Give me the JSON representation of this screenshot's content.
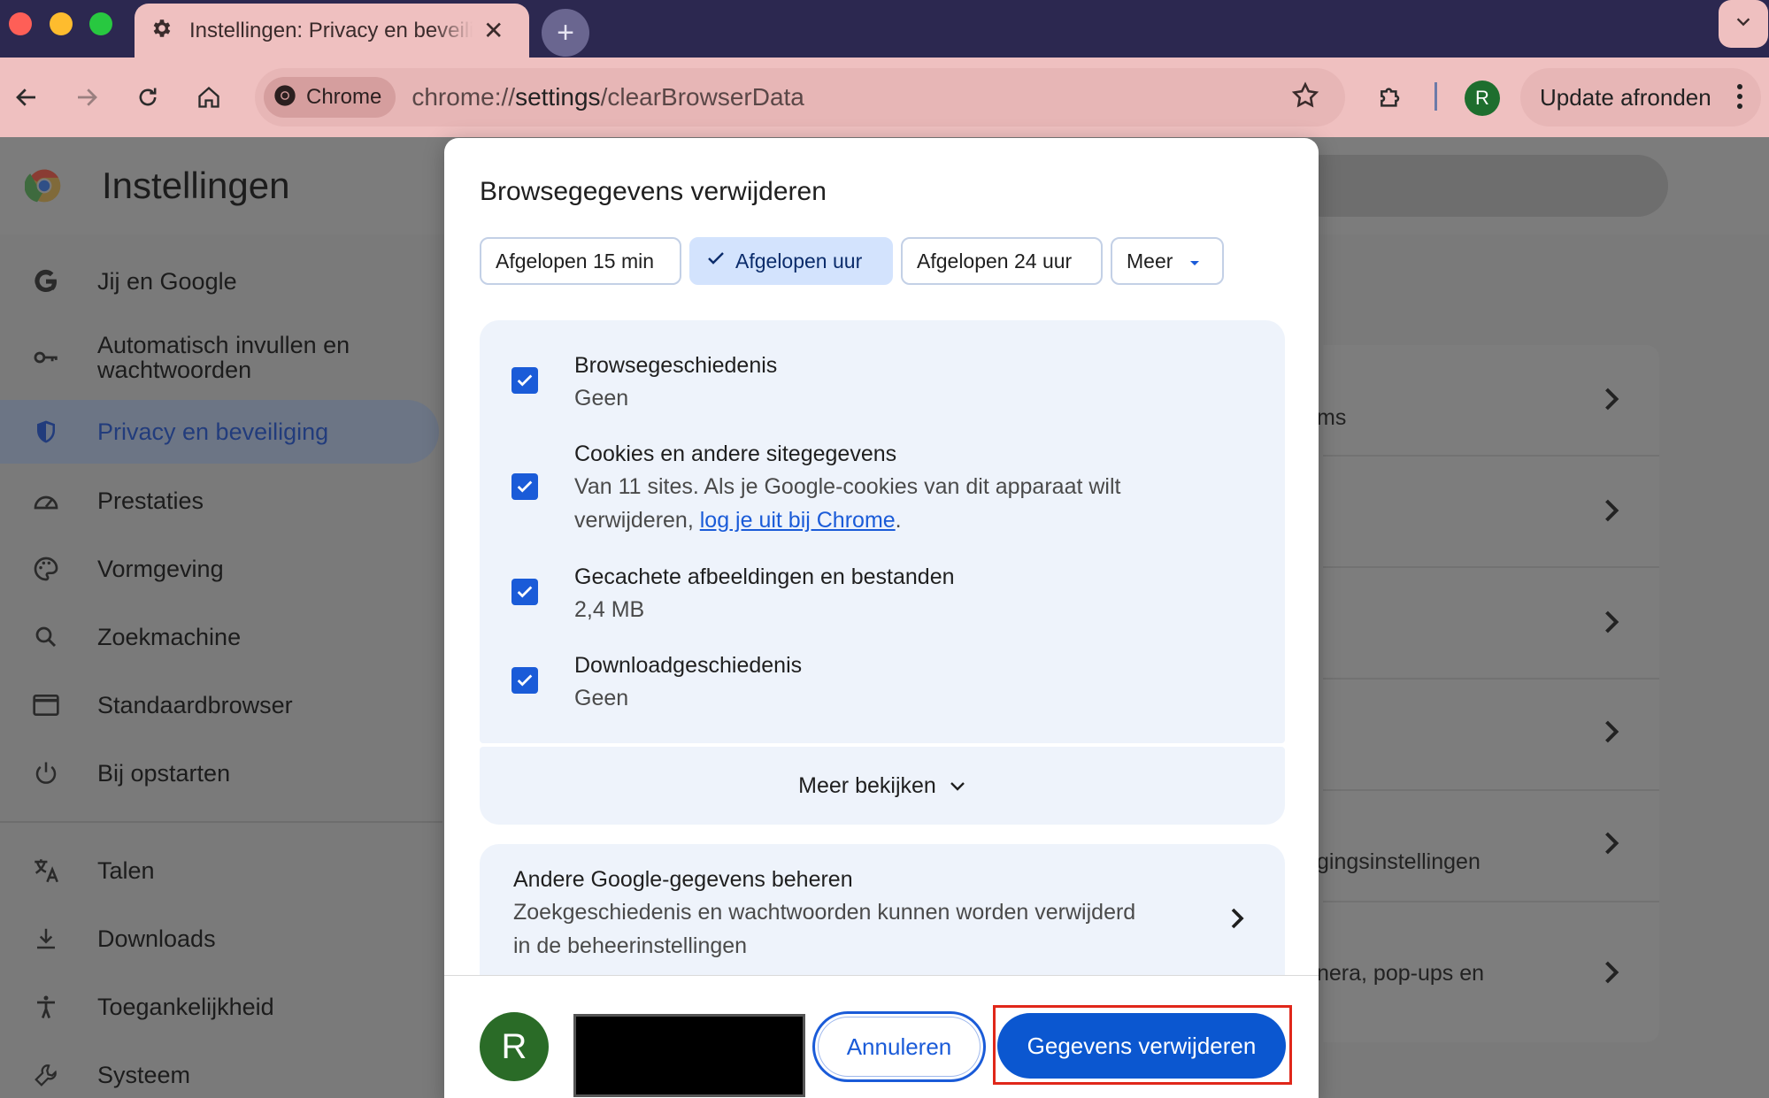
{
  "browser": {
    "tab_title": "Instellingen: Privacy en beveiliging",
    "tab_close": "✕",
    "new_tab": "+",
    "omnibox_chip": "Chrome",
    "url_prefix": "chrome://",
    "url_bold": "settings",
    "url_rest": "/clearBrowserData",
    "update_label": "Update afronden",
    "profile_initial": "R",
    "colors": {
      "titlebar": "#2c2850",
      "toolbar": "#efc0c0"
    }
  },
  "settings": {
    "title": "Instellingen",
    "sidebar": [
      {
        "label": "Jij en Google",
        "icon": "google-g-icon"
      },
      {
        "label": "Automatisch invullen en wachtwoorden",
        "icon": "key-icon"
      },
      {
        "label": "Privacy en beveiliging",
        "icon": "shield-icon",
        "active": true
      },
      {
        "label": "Prestaties",
        "icon": "gauge-icon"
      },
      {
        "label": "Vormgeving",
        "icon": "palette-icon"
      },
      {
        "label": "Zoekmachine",
        "icon": "search-icon"
      },
      {
        "label": "Standaardbrowser",
        "icon": "browser-window-icon"
      },
      {
        "label": "Bij opstarten",
        "icon": "power-icon"
      },
      {
        "label": "Talen",
        "icon": "translate-icon"
      },
      {
        "label": "Downloads",
        "icon": "download-icon"
      },
      {
        "label": "Toegankelijkheid",
        "icon": "accessibility-icon"
      },
      {
        "label": "Systeem",
        "icon": "wrench-icon"
      }
    ],
    "card_fragments": [
      "ms",
      "gingsinstellingen",
      "nera, pop-ups en"
    ]
  },
  "dialog": {
    "title": "Browsegegevens verwijderen",
    "time_ranges": [
      {
        "label": "Afgelopen 15 min",
        "selected": false
      },
      {
        "label": "Afgelopen uur",
        "selected": true
      },
      {
        "label": "Afgelopen 24 uur",
        "selected": false
      },
      {
        "label": "Meer",
        "selected": false
      }
    ],
    "options": [
      {
        "title": "Browsegeschiedenis",
        "sub": "Geen",
        "checked": true
      },
      {
        "title": "Cookies en andere sitegegevens",
        "sub_line1": "Van 11 sites. Als je Google-cookies van dit apparaat wilt",
        "sub_line2_prefix": "verwijderen, ",
        "sub_link": "log je uit bij Chrome",
        "sub_line2_suffix": ".",
        "checked": true
      },
      {
        "title": "Gecachete afbeeldingen en bestanden",
        "sub": "2,4 MB",
        "checked": true
      },
      {
        "title": "Downloadgeschiedenis",
        "sub": "Geen",
        "checked": true
      }
    ],
    "more_label": "Meer bekijken",
    "google_data": {
      "title": "Andere Google-gegevens beheren",
      "line1": "Zoekgeschiedenis en wachtwoorden kunnen worden verwijderd",
      "line2": "in de beheerinstellingen"
    },
    "account_initial": "R",
    "cancel_label": "Annuleren",
    "delete_label": "Gegevens verwijderen",
    "colors": {
      "accent": "#0b57d0",
      "highlight": "#e0271a"
    }
  }
}
